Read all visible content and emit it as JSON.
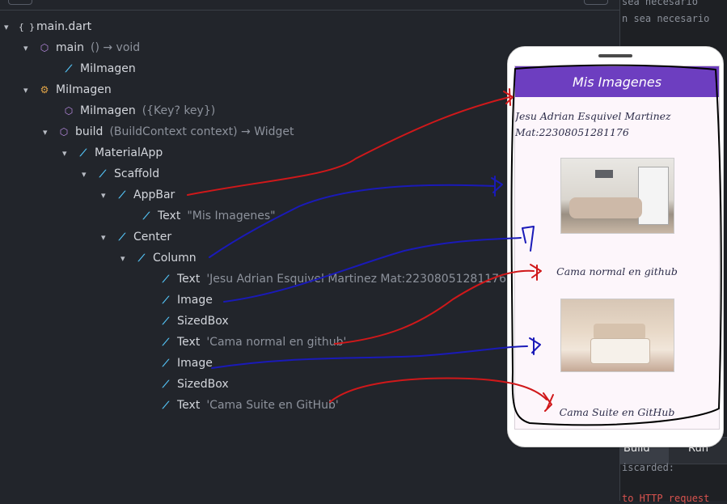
{
  "editor": {
    "tree": [
      {
        "label": "main.dart",
        "sig": "",
        "icon": "braces-icon"
      },
      {
        "label": "main",
        "sig": "() → void",
        "icon": "cube-icon"
      },
      {
        "label": "MiImagen",
        "sig": "",
        "icon": "flutter-icon"
      },
      {
        "label": "MiImagen",
        "sig": "",
        "icon": "class-icon"
      },
      {
        "label": "MiImagen",
        "sig": "({Key? key})",
        "icon": "cube-icon"
      },
      {
        "label": "build",
        "sig": "(BuildContext context) → Widget",
        "icon": "cube-icon"
      },
      {
        "label": "MaterialApp",
        "sig": "",
        "icon": "flutter-icon"
      },
      {
        "label": "Scaffold",
        "sig": "",
        "icon": "flutter-icon"
      },
      {
        "label": "AppBar",
        "sig": "",
        "icon": "flutter-icon"
      },
      {
        "label": "Text",
        "sig": "\"Mis Imagenes\"",
        "icon": "flutter-icon"
      },
      {
        "label": "Center",
        "sig": "",
        "icon": "flutter-icon"
      },
      {
        "label": "Column",
        "sig": "",
        "icon": "flutter-icon"
      },
      {
        "label": "Text",
        "sig": "'Jesu Adrian Esquivel Martinez Mat:22308051281176'",
        "icon": "flutter-icon"
      },
      {
        "label": "Image",
        "sig": "",
        "icon": "flutter-icon"
      },
      {
        "label": "SizedBox",
        "sig": "",
        "icon": "flutter-icon"
      },
      {
        "label": "Text",
        "sig": "'Cama normal en github'",
        "icon": "flutter-icon"
      },
      {
        "label": "Image",
        "sig": "",
        "icon": "flutter-icon"
      },
      {
        "label": "SizedBox",
        "sig": "",
        "icon": "flutter-icon"
      },
      {
        "label": "Text",
        "sig": "'Cama Suite en GitHub'",
        "icon": "flutter-icon"
      }
    ]
  },
  "side_panel": {
    "code_top_1": "sea necesario",
    "code_top_2": "n sea necesario",
    "build_label": "Build",
    "run_label": "Run",
    "console_1": "iscarded:",
    "console_2": "to HTTP request"
  },
  "phone": {
    "appbar_title": "Mis Imagenes",
    "author_line1": "Jesu Adrian Esquivel Martinez",
    "author_line2": "Mat:22308051281176",
    "caption1": "Cama normal en github",
    "caption2": "Cama Suite en GitHub",
    "accent": "#6d3ec0"
  },
  "annotation_colors": {
    "red": "#d0181a",
    "blue": "#1a1ab8",
    "black": "#000000"
  }
}
